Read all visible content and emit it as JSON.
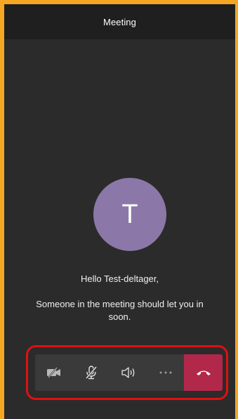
{
  "header": {
    "title": "Meeting"
  },
  "avatar": {
    "initial": "T",
    "color": "#8b78a8"
  },
  "lobby": {
    "greeting": "Hello Test-deltager,",
    "message": "Someone in the meeting should let you in soon."
  },
  "toolbar": {
    "buttons": [
      {
        "icon": "video-off-icon"
      },
      {
        "icon": "mic-off-icon"
      },
      {
        "icon": "speaker-icon"
      },
      {
        "icon": "more-icon"
      },
      {
        "icon": "hang-up-icon",
        "color": "#b2284a"
      }
    ]
  },
  "colors": {
    "highlight_border": "#e01010",
    "page_frame": "#f5a623",
    "background": "#2b2b2b"
  }
}
